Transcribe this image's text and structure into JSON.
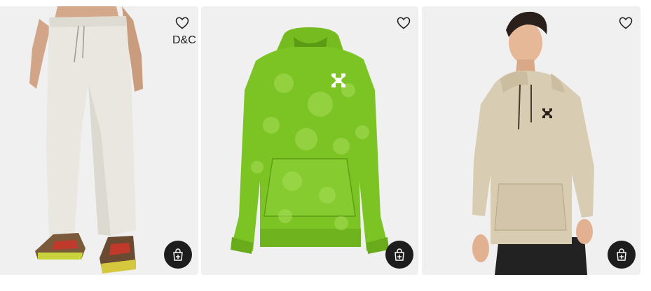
{
  "products": [
    {
      "badge": "D&C",
      "wishlist_icon": "heart-outline-icon",
      "quick_add_icon": "bag-plus-icon",
      "bg": "#f0f0f0"
    },
    {
      "badge": "",
      "wishlist_icon": "heart-outline-icon",
      "quick_add_icon": "bag-plus-icon",
      "bg": "#f0f0f0",
      "accent": "#7cc324"
    },
    {
      "badge": "",
      "wishlist_icon": "heart-outline-icon",
      "quick_add_icon": "bag-plus-icon",
      "bg": "#f0f0f0",
      "accent": "#d8ccb2"
    }
  ]
}
